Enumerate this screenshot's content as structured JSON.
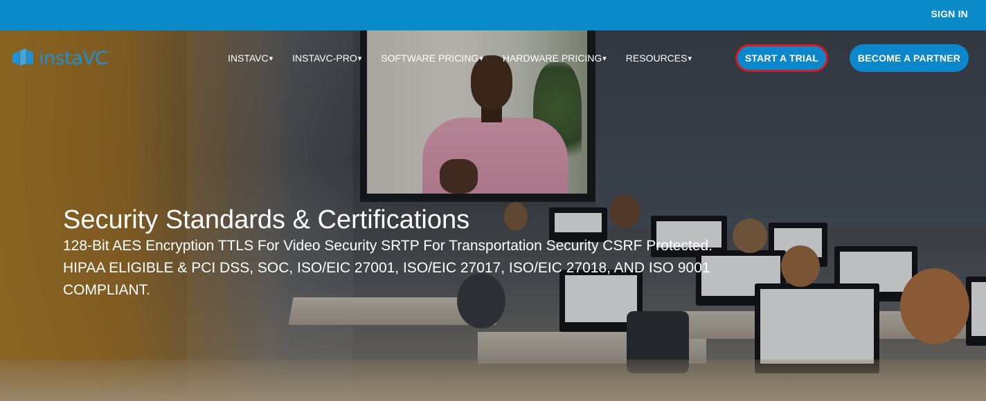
{
  "topbar": {
    "signin_label": "SIGN IN",
    "color": "#0a8ac8"
  },
  "logo": {
    "text": "instaVC",
    "icon": "cube-logo-icon",
    "color": "#1e90d6"
  },
  "nav": {
    "items": [
      {
        "label": "INSTAVC",
        "caret": "▾"
      },
      {
        "label": "INSTAVC-PRO",
        "caret": "▾"
      },
      {
        "label": "SOFTWARE PRICING",
        "caret": "▾"
      },
      {
        "label": "HARDWARE PRICING",
        "caret": "▾"
      },
      {
        "label": "RESOURCES",
        "caret": "▾"
      }
    ],
    "trial_button": "START A TRIAL",
    "partner_button": "BECOME A PARTNER",
    "accent": "#0c87cc",
    "highlight_border": "#d5191f"
  },
  "hero": {
    "title": "Security Standards & Certifications",
    "description": "128-Bit AES Encryption TTLS For Video Security SRTP For Transportation Security CSRF Protected. HIPAA ELIGIBLE & PCI DSS, SOC, ISO/EIC 27001, ISO/EIC 27017, ISO/EIC 27018, AND ISO 9001 COMPLIANT."
  }
}
